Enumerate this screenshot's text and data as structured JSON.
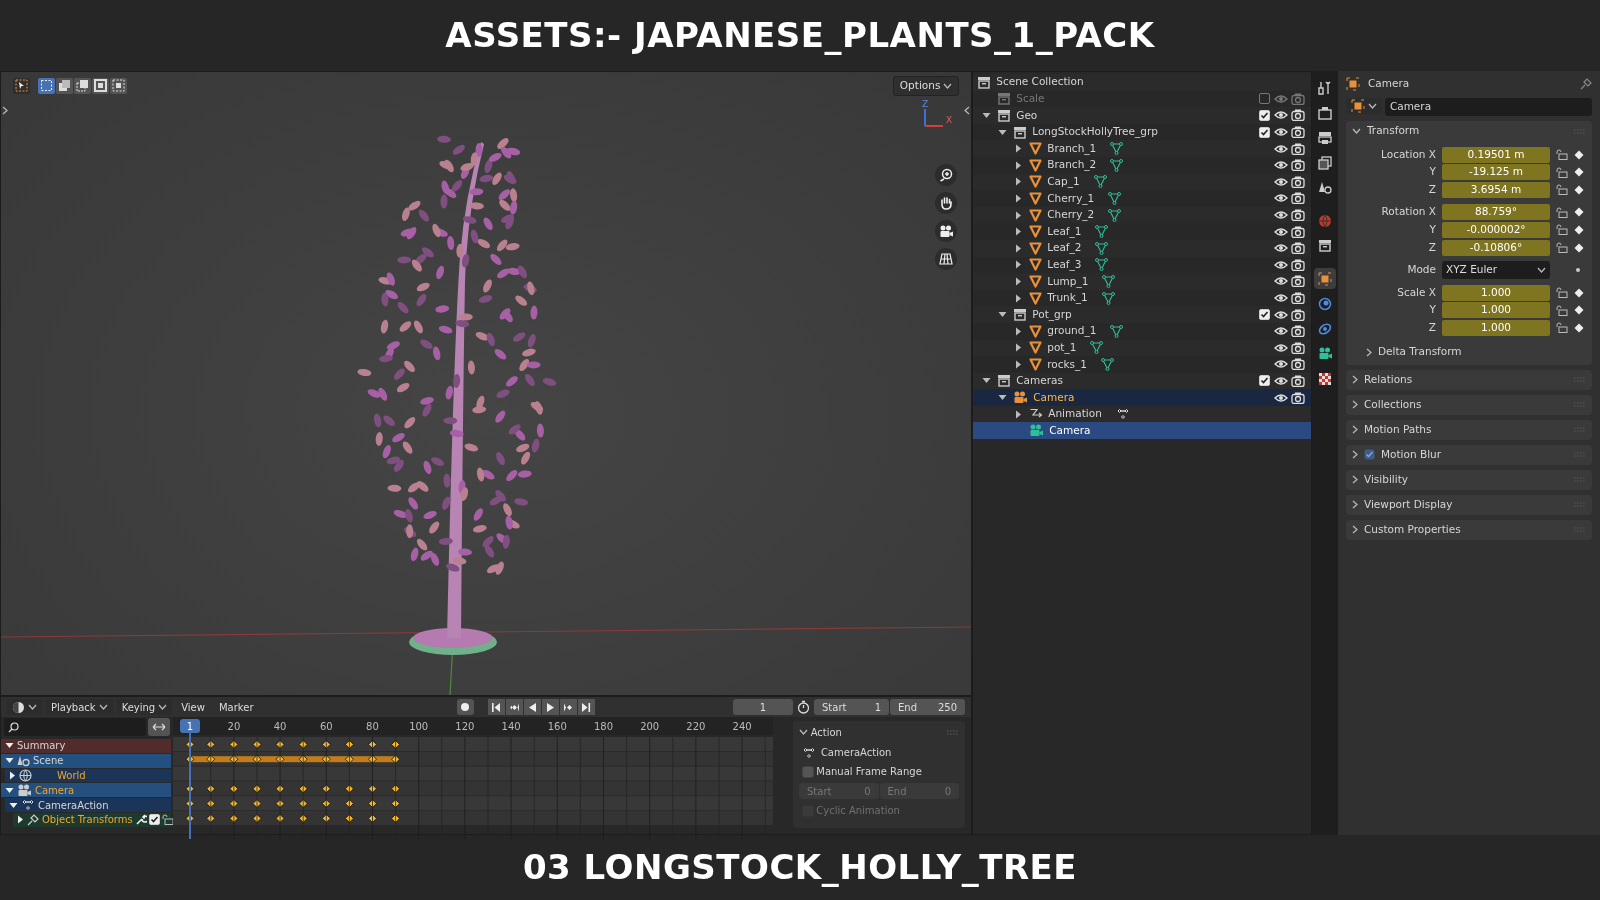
{
  "banner_title": "ASSETS:- JAPANESE_PLANTS_1_PACK",
  "viewport": {
    "select_modes": [
      {
        "selected": true
      },
      {
        "selected": false
      },
      {
        "selected": false
      },
      {
        "selected": false
      },
      {
        "selected": false
      }
    ],
    "options_label": "Options",
    "gizmo_labels": [
      "Z",
      "X"
    ]
  },
  "timeline": {
    "menus": [
      {
        "label": "Playback",
        "dropdown": true
      },
      {
        "label": "Keying",
        "dropdown": true
      },
      {
        "label": "View",
        "dropdown": false
      },
      {
        "label": "Marker",
        "dropdown": false
      }
    ],
    "current_frame": "1",
    "start_label": "Start",
    "start": "1",
    "end_label": "End",
    "end": "250",
    "current_frame_badge": "1",
    "ruler_labels": [
      "20",
      "40",
      "60",
      "80",
      "100",
      "120",
      "140",
      "160",
      "180",
      "200",
      "220",
      "240"
    ],
    "channels": [
      {
        "label": "Summary",
        "kind": "summary",
        "expanded": true,
        "selected": false,
        "keyed": true,
        "hold": false
      },
      {
        "label": "Scene",
        "kind": "scene",
        "expanded": true,
        "selected": false,
        "keyed": true,
        "hold": true,
        "children": [
          {
            "label": "World",
            "kind": "world",
            "expanded": false,
            "selected": true,
            "keyed": false,
            "hold": false
          }
        ]
      },
      {
        "label": "Camera",
        "kind": "object",
        "expanded": true,
        "selected": true,
        "keyed": true,
        "hold": false,
        "children": [
          {
            "label": "CameraAction",
            "kind": "action",
            "expanded": true,
            "selected": false,
            "keyed": true,
            "hold": false,
            "children": [
              {
                "label": "Object Transforms",
                "kind": "group",
                "expanded": false,
                "selected": true,
                "keyed": true,
                "hold": false
              }
            ]
          }
        ]
      }
    ],
    "action_panel": {
      "title": "Action",
      "action_name": "CameraAction",
      "manual_range": {
        "label": "Manual Frame Range",
        "checked": false
      },
      "start_label": "Start",
      "start": "0",
      "end_label": "End",
      "end": "0",
      "cyclic": {
        "label": "Cyclic Animation",
        "checked": false,
        "disabled": true
      }
    }
  },
  "outliner": {
    "root": {
      "label": "Scene Collection",
      "children": [
        {
          "label": "Scale",
          "kind": "collection",
          "checked": false,
          "disabled": true,
          "selected": false,
          "active": false
        },
        {
          "label": "Geo",
          "kind": "collection",
          "expanded": true,
          "checked": true,
          "disabled": false,
          "selected": false,
          "active": false,
          "children": [
            {
              "label": "LongStockHollyTree_grp",
              "kind": "collection",
              "expanded": true,
              "checked": true,
              "disabled": false,
              "selected": false,
              "active": false,
              "children": [
                {
                  "label": "Branch_1",
                  "kind": "mesh",
                  "expanded": false,
                  "disabled": false,
                  "selected": false,
                  "active": false
                },
                {
                  "label": "Branch_2",
                  "kind": "mesh",
                  "expanded": false,
                  "disabled": false,
                  "selected": false,
                  "active": false
                },
                {
                  "label": "Cap_1",
                  "kind": "mesh",
                  "expanded": false,
                  "disabled": false,
                  "selected": false,
                  "active": false
                },
                {
                  "label": "Cherry_1",
                  "kind": "mesh",
                  "expanded": false,
                  "disabled": false,
                  "selected": false,
                  "active": false
                },
                {
                  "label": "Cherry_2",
                  "kind": "mesh",
                  "expanded": false,
                  "disabled": false,
                  "selected": false,
                  "active": false
                },
                {
                  "label": "Leaf_1",
                  "kind": "mesh",
                  "expanded": false,
                  "disabled": false,
                  "selected": false,
                  "active": false
                },
                {
                  "label": "Leaf_2",
                  "kind": "mesh",
                  "expanded": false,
                  "disabled": false,
                  "selected": false,
                  "active": false
                },
                {
                  "label": "Leaf_3",
                  "kind": "mesh",
                  "expanded": false,
                  "disabled": false,
                  "selected": false,
                  "active": false
                },
                {
                  "label": "Lump_1",
                  "kind": "mesh",
                  "expanded": false,
                  "disabled": false,
                  "selected": false,
                  "active": false
                },
                {
                  "label": "Trunk_1",
                  "kind": "mesh",
                  "expanded": false,
                  "disabled": false,
                  "selected": false,
                  "active": false
                }
              ]
            },
            {
              "label": "Pot_grp",
              "kind": "collection",
              "expanded": true,
              "checked": true,
              "disabled": false,
              "selected": false,
              "active": false,
              "children": [
                {
                  "label": "ground_1",
                  "kind": "mesh",
                  "expanded": false,
                  "disabled": false,
                  "selected": false,
                  "active": false
                },
                {
                  "label": "pot_1",
                  "kind": "mesh",
                  "expanded": false,
                  "disabled": false,
                  "selected": false,
                  "active": false
                },
                {
                  "label": "rocks_1",
                  "kind": "mesh",
                  "expanded": false,
                  "disabled": false,
                  "selected": false,
                  "active": false
                }
              ]
            }
          ]
        },
        {
          "label": "Cameras",
          "kind": "collection",
          "expanded": true,
          "checked": true,
          "disabled": false,
          "selected": false,
          "active": false,
          "children": [
            {
              "label": "Camera",
              "kind": "camera_object",
              "expanded": true,
              "disabled": false,
              "selected": true,
              "active": false,
              "children": [
                {
                  "label": "Animation",
                  "kind": "animation",
                  "expanded": false,
                  "disabled": false,
                  "selected": false,
                  "active": false
                },
                {
                  "label": "Camera",
                  "kind": "camera_data",
                  "disabled": false,
                  "selected": true,
                  "active": true
                }
              ]
            }
          ]
        }
      ]
    }
  },
  "properties": {
    "tabs": [
      {
        "kind": "tool",
        "selected": false
      },
      {
        "kind": "render",
        "selected": false
      },
      {
        "kind": "output",
        "selected": false
      },
      {
        "kind": "view_layer",
        "selected": false
      },
      {
        "kind": "scene",
        "selected": false
      },
      {
        "kind": "world",
        "selected": false
      },
      {
        "kind": "collection",
        "selected": false
      },
      {
        "kind": "object",
        "selected": true
      },
      {
        "kind": "physics",
        "selected": false
      },
      {
        "kind": "constraints",
        "selected": false
      },
      {
        "kind": "camera_data",
        "selected": false
      },
      {
        "kind": "texture",
        "selected": false
      }
    ],
    "header": "Camera",
    "object_name": "Camera",
    "transform": {
      "title": "Transform",
      "expanded": true,
      "groups": [
        {
          "rows": [
            {
              "kind": "value",
              "label": "Location X",
              "value": "0.19501 m",
              "animated": true,
              "locked": false
            },
            {
              "kind": "value",
              "label": "Y",
              "value": "-19.125 m",
              "animated": true,
              "locked": false
            },
            {
              "kind": "value",
              "label": "Z",
              "value": "3.6954 m",
              "animated": true,
              "locked": false
            }
          ]
        },
        {
          "rows": [
            {
              "kind": "value",
              "label": "Rotation X",
              "value": "88.759°",
              "animated": true,
              "locked": false
            },
            {
              "kind": "value",
              "label": "Y",
              "value": "-0.000002°",
              "animated": true,
              "locked": false
            },
            {
              "kind": "value",
              "label": "Z",
              "value": "-0.10806°",
              "animated": true,
              "locked": false
            }
          ]
        },
        {
          "rows": [
            {
              "kind": "dropdown",
              "label": "Mode",
              "value": "XYZ Euler"
            }
          ]
        },
        {
          "rows": [
            {
              "kind": "value",
              "label": "Scale X",
              "value": "1.000",
              "animated": true,
              "locked": false
            },
            {
              "kind": "value",
              "label": "Y",
              "value": "1.000",
              "animated": true,
              "locked": false
            },
            {
              "kind": "value",
              "label": "Z",
              "value": "1.000",
              "animated": true,
              "locked": false
            }
          ]
        }
      ],
      "subpanel": {
        "title": "Delta Transform",
        "expanded": false
      }
    },
    "panels": [
      {
        "title": "Relations",
        "expanded": false
      },
      {
        "title": "Collections",
        "expanded": false
      },
      {
        "title": "Motion Paths",
        "expanded": false
      },
      {
        "title": "Motion Blur",
        "expanded": false,
        "checked": true
      },
      {
        "title": "Visibility",
        "expanded": false
      },
      {
        "title": "Viewport Display",
        "expanded": false
      },
      {
        "title": "Custom Properties",
        "expanded": false
      }
    ]
  },
  "footer_title": "03 LONGSTOCK_HOLLY_TREE"
}
